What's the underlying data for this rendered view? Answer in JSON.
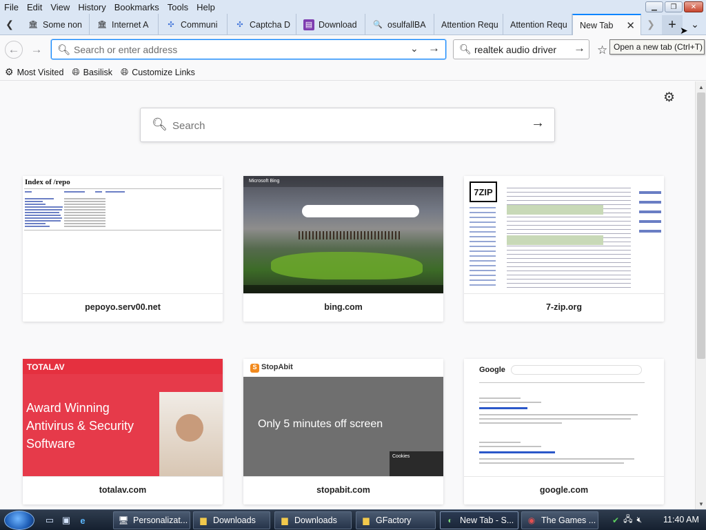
{
  "menubar": {
    "items": [
      {
        "label": "File"
      },
      {
        "label": "Edit"
      },
      {
        "label": "View"
      },
      {
        "label": "History"
      },
      {
        "label": "Bookmarks"
      },
      {
        "label": "Tools"
      },
      {
        "label": "Help"
      }
    ]
  },
  "tabs": [
    {
      "label": "Some non",
      "icon": "page-icon"
    },
    {
      "label": "Internet A",
      "icon": "archive-icon"
    },
    {
      "label": "Communi",
      "icon": "puzzle-icon"
    },
    {
      "label": "Captcha D",
      "icon": "puzzle-icon"
    },
    {
      "label": "Download",
      "icon": "download-site-icon"
    },
    {
      "label": "osulfallBA",
      "icon": "search-icon"
    },
    {
      "label": "Attention Requ",
      "icon": ""
    },
    {
      "label": "Attention Requ",
      "icon": ""
    },
    {
      "label": "New Tab",
      "icon": "",
      "active": true
    }
  ],
  "tooltip": {
    "text": "Open a new tab (Ctrl+T)"
  },
  "navbar": {
    "url_placeholder": "Search or enter address",
    "search_value": "realtek audio driver"
  },
  "bookmarks": [
    {
      "label": "Most Visited",
      "icon": "gear-icon"
    },
    {
      "label": "Basilisk",
      "icon": "globe-icon"
    },
    {
      "label": "Customize Links",
      "icon": "globe-icon"
    }
  ],
  "newtab": {
    "search_placeholder": "Search",
    "tiles": [
      {
        "title": "pepoyo.serv00.net",
        "thumb_header": "Index of /repo"
      },
      {
        "title": "bing.com",
        "thumb_header": "Microsoft Bing"
      },
      {
        "title": "7-zip.org",
        "thumb_header": "7ZIP"
      },
      {
        "title": "totalav.com",
        "thumb_header": "TOTALAV",
        "thumb_hero": "Award Winning Antivirus & Security Software"
      },
      {
        "title": "stopabit.com",
        "thumb_header": "StopAbit",
        "thumb_hero": "Only 5 minutes off screen",
        "thumb_cookie": "Cookies"
      },
      {
        "title": "google.com",
        "thumb_header": "Google"
      }
    ]
  },
  "taskbar": {
    "items": [
      {
        "label": "Personalizat..."
      },
      {
        "label": "Downloads"
      },
      {
        "label": "Downloads"
      },
      {
        "label": "GFactory"
      },
      {
        "label": "New Tab - S..."
      },
      {
        "label": "The Games ..."
      }
    ],
    "clock": "11:40 AM"
  },
  "colors": {
    "accent": "#0a84ff",
    "chrome_bg": "#dbe6f4",
    "taskbar_bg": "#1c2838"
  }
}
